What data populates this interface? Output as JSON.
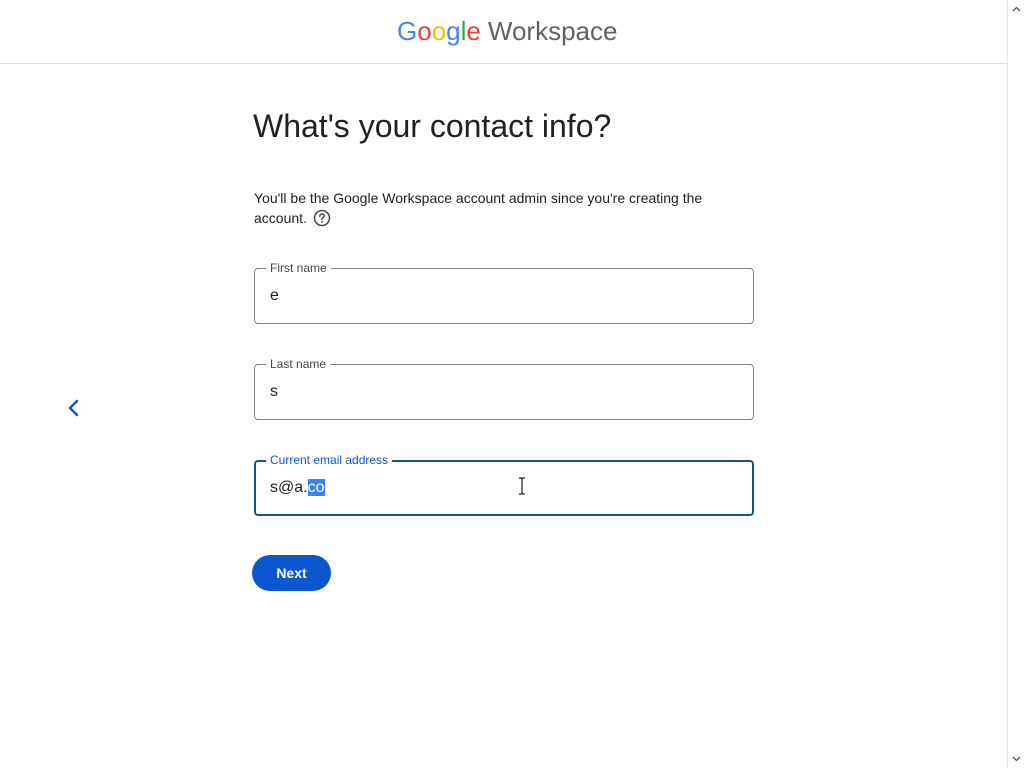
{
  "header": {
    "logo_letters": [
      "G",
      "o",
      "o",
      "g",
      "l",
      "e"
    ],
    "product_name": "Workspace"
  },
  "main": {
    "title": "What's your contact info?",
    "description": "You'll be the Google Workspace account admin since you're creating the account.",
    "fields": {
      "first_name": {
        "label": "First name",
        "value": "e"
      },
      "last_name": {
        "label": "Last name",
        "value": "s"
      },
      "email": {
        "label": "Current email address",
        "value_unselected": "s@a.",
        "value_selected": "co"
      }
    },
    "next_label": "Next"
  },
  "icons": {
    "back": "chevron-left-icon",
    "help": "help-circle-icon",
    "cursor": "text-cursor-icon",
    "scroll_up": "scroll-up-arrow-icon",
    "scroll_down": "scroll-down-arrow-icon"
  },
  "colors": {
    "primary_button": "#0b57d0",
    "focused_border": "#0e5a7f",
    "focused_label": "#0b57d0",
    "selection": "#3b82f6",
    "back_arrow": "#0b57d0"
  }
}
